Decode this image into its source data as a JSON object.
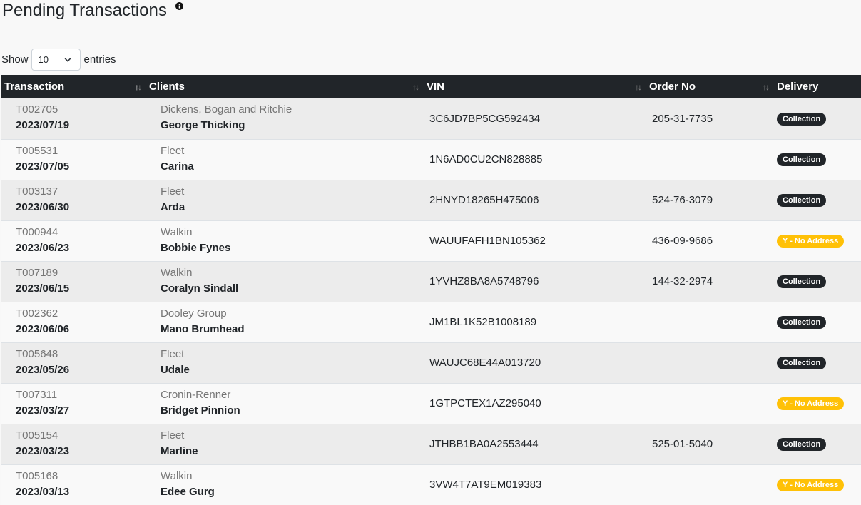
{
  "page": {
    "title": "Pending Transactions"
  },
  "length": {
    "show_label": "Show",
    "value": "10",
    "entries_label": "entries"
  },
  "table": {
    "columns": [
      "Transaction",
      "Clients",
      "VIN",
      "Order No",
      "Delivery"
    ],
    "rows": [
      {
        "id": "T002705",
        "date": "2023/07/19",
        "company": "Dickens, Bogan and Ritchie",
        "client": "George Thicking",
        "vin": "3C6JD7BP5CG592434",
        "order": "205-31-7735",
        "delivery": "Collection",
        "delivery_type": "dark"
      },
      {
        "id": "T005531",
        "date": "2023/07/05",
        "company": "Fleet",
        "client": "Carina",
        "vin": "1N6AD0CU2CN828885",
        "order": "",
        "delivery": "Collection",
        "delivery_type": "dark"
      },
      {
        "id": "T003137",
        "date": "2023/06/30",
        "company": "Fleet",
        "client": "Arda",
        "vin": "2HNYD18265H475006",
        "order": "524-76-3079",
        "delivery": "Collection",
        "delivery_type": "dark"
      },
      {
        "id": "T000944",
        "date": "2023/06/23",
        "company": "Walkin",
        "client": "Bobbie Fynes",
        "vin": "WAUUFAFH1BN105362",
        "order": "436-09-9686",
        "delivery": "Y - No Address",
        "delivery_type": "warn"
      },
      {
        "id": "T007189",
        "date": "2023/06/15",
        "company": "Walkin",
        "client": "Coralyn Sindall",
        "vin": "1YVHZ8BA8A5748796",
        "order": "144-32-2974",
        "delivery": "Collection",
        "delivery_type": "dark"
      },
      {
        "id": "T002362",
        "date": "2023/06/06",
        "company": "Dooley Group",
        "client": "Mano Brumhead",
        "vin": "JM1BL1K52B1008189",
        "order": "",
        "delivery": "Collection",
        "delivery_type": "dark"
      },
      {
        "id": "T005648",
        "date": "2023/05/26",
        "company": "Fleet",
        "client": "Udale",
        "vin": "WAUJC68E44A013720",
        "order": "",
        "delivery": "Collection",
        "delivery_type": "dark"
      },
      {
        "id": "T007311",
        "date": "2023/03/27",
        "company": "Cronin-Renner",
        "client": "Bridget Pinnion",
        "vin": "1GTPCTEX1AZ295040",
        "order": "",
        "delivery": "Y - No Address",
        "delivery_type": "warn"
      },
      {
        "id": "T005154",
        "date": "2023/03/23",
        "company": "Fleet",
        "client": "Marline",
        "vin": "JTHBB1BA0A2553444",
        "order": "525-01-5040",
        "delivery": "Collection",
        "delivery_type": "dark"
      },
      {
        "id": "T005168",
        "date": "2023/03/13",
        "company": "Walkin",
        "client": "Edee Gurg",
        "vin": "3VW4T7AT9EM019383",
        "order": "",
        "delivery": "Y - No Address",
        "delivery_type": "warn"
      }
    ]
  },
  "colors": {
    "header_bg": "#212529",
    "badge_dark": "#212529",
    "badge_warn": "#ffc107",
    "row_odd": "#ececec",
    "row_even": "#f9f9f9"
  },
  "icons": {
    "title_info": "info-icon",
    "select_chevron": "chevron-down-icon",
    "sort": "sort-icon"
  }
}
